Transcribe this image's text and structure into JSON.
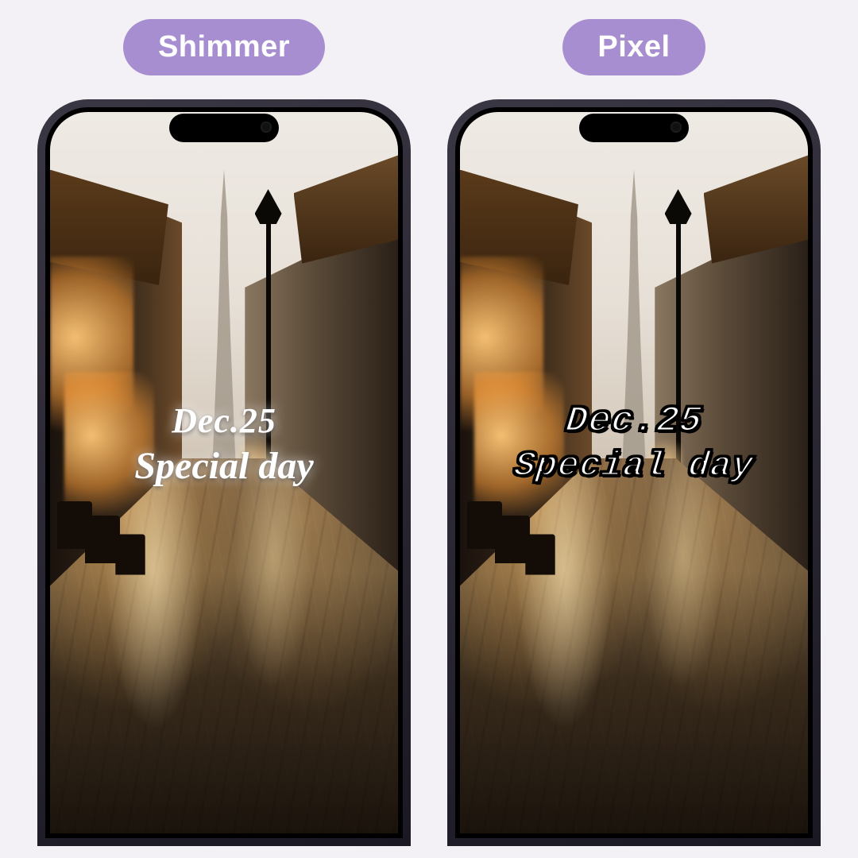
{
  "labels": {
    "left": "Shimmer",
    "right": "Pixel"
  },
  "overlay": {
    "line1": "Dec.25",
    "line2": "Special day"
  },
  "colors": {
    "pill_bg": "#a78ed0",
    "pill_text": "#ffffff",
    "page_bg": "#f3f1f6"
  }
}
